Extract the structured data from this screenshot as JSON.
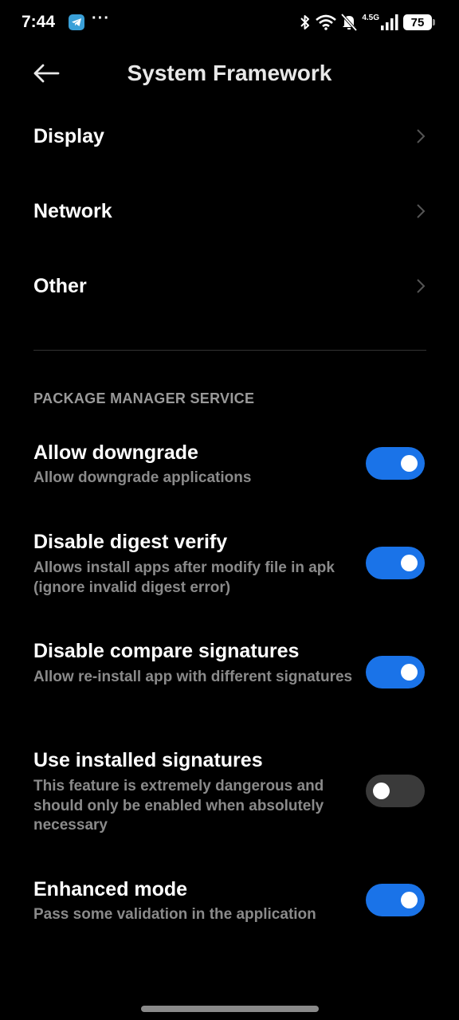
{
  "status_bar": {
    "time": "7:44",
    "more": "···",
    "network_type": "4.5G",
    "battery": "75",
    "icons": [
      "telegram-icon",
      "bluetooth-icon",
      "wifi-icon",
      "silent-icon",
      "signal-icon",
      "battery-icon"
    ]
  },
  "header": {
    "title": "System Framework",
    "back_icon": "back-arrow-icon"
  },
  "nav_items": [
    {
      "label": "Display"
    },
    {
      "label": "Network"
    },
    {
      "label": "Other"
    }
  ],
  "section": {
    "title": "PACKAGE MANAGER SERVICE"
  },
  "settings": [
    {
      "title": "Allow downgrade",
      "description": "Allow downgrade applications",
      "enabled": true
    },
    {
      "title": "Disable digest verify",
      "description": "Allows install apps after modify file in apk (ignore invalid digest error)",
      "enabled": true
    },
    {
      "title": "Disable compare signatures",
      "description": "Allow re-install app with different signatures",
      "enabled": true
    },
    {
      "title": "Use installed signatures",
      "description": "This feature is extremely dangerous and should only be enabled when absolutely necessary",
      "enabled": false
    },
    {
      "title": "Enhanced mode",
      "description": "Pass some validation in the application",
      "enabled": true
    }
  ],
  "colors": {
    "background": "#000000",
    "accent": "#1a73e8",
    "toggle_off": "#3a3a3a",
    "secondary_text": "#8a8a8a"
  }
}
